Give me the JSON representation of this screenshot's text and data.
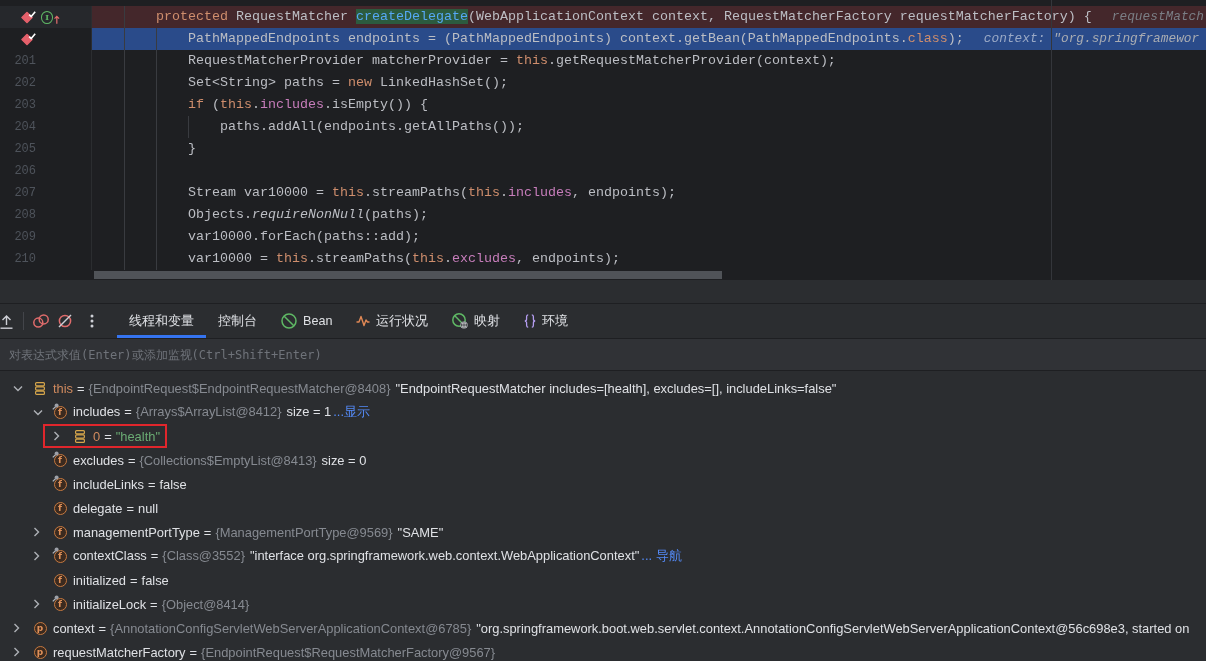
{
  "editor": {
    "lines": [
      {
        "kind": "breakpoint",
        "breakpoint": true,
        "gutter_marker": "I",
        "tokens": [
          {
            "kind": "keyword",
            "text": "    protected"
          },
          {
            "kind": "plain",
            "text": " RequestMatcher "
          },
          {
            "kind": "highlight",
            "text": "createDelegate"
          },
          {
            "kind": "plain",
            "text": "(WebApplicationContext context, RequestMatcherFactory requestMatcherFactory) {"
          }
        ],
        "hint": {
          "label": "requestMatch"
        }
      },
      {
        "kind": "execution",
        "breakpoint": true,
        "tokens": [
          {
            "kind": "plain",
            "text": "        PathMappedEndpoints endpoints = (PathMappedEndpoints) context.getBean(PathMappedEndpoints."
          },
          {
            "kind": "keyword",
            "text": "class"
          },
          {
            "kind": "plain",
            "text": ");"
          }
        ],
        "hint": {
          "label": "context:",
          "value": "\"org.springframewor"
        }
      },
      {
        "kind": "plain",
        "breakpoint": false,
        "number": "201",
        "tokens": [
          {
            "kind": "plain",
            "text": "        RequestMatcherProvider matcherProvider = "
          },
          {
            "kind": "keyword",
            "text": "this"
          },
          {
            "kind": "plain",
            "text": ".getRequestMatcherProvider(context);"
          }
        ]
      },
      {
        "kind": "plain",
        "breakpoint": false,
        "number": "202",
        "tokens": [
          {
            "kind": "plain",
            "text": "        Set<String> paths = "
          },
          {
            "kind": "keyword",
            "text": "new"
          },
          {
            "kind": "plain",
            "text": " LinkedHashSet();"
          }
        ]
      },
      {
        "kind": "plain",
        "breakpoint": false,
        "number": "203",
        "tokens": [
          {
            "kind": "keyword",
            "text": "        if"
          },
          {
            "kind": "plain",
            "text": " ("
          },
          {
            "kind": "keyword",
            "text": "this"
          },
          {
            "kind": "plain",
            "text": "."
          },
          {
            "kind": "field",
            "text": "includes"
          },
          {
            "kind": "plain",
            "text": ".isEmpty()) {"
          }
        ]
      },
      {
        "kind": "plain",
        "breakpoint": false,
        "number": "204",
        "tokens": [
          {
            "kind": "plain",
            "text": "            paths.addAll(endpoints.getAllPaths());"
          }
        ]
      },
      {
        "kind": "plain",
        "breakpoint": false,
        "number": "205",
        "tokens": [
          {
            "kind": "plain",
            "text": "        }"
          }
        ]
      },
      {
        "kind": "plain",
        "breakpoint": false,
        "number": "206"
      },
      {
        "kind": "plain",
        "breakpoint": false,
        "number": "207",
        "tokens": [
          {
            "kind": "plain",
            "text": "        Stream var10000 = "
          },
          {
            "kind": "keyword",
            "text": "this"
          },
          {
            "kind": "plain",
            "text": ".streamPaths("
          },
          {
            "kind": "keyword",
            "text": "this"
          },
          {
            "kind": "plain",
            "text": "."
          },
          {
            "kind": "field",
            "text": "includes"
          },
          {
            "kind": "plain",
            "text": ", endpoints);"
          }
        ]
      },
      {
        "kind": "plain",
        "breakpoint": false,
        "number": "208",
        "tokens": [
          {
            "kind": "plain",
            "text": "        Objects."
          },
          {
            "kind": "italic",
            "text": "requireNonNull"
          },
          {
            "kind": "plain",
            "text": "(paths);"
          }
        ]
      },
      {
        "kind": "plain",
        "breakpoint": false,
        "number": "209",
        "tokens": [
          {
            "kind": "plain",
            "text": "        var10000.forEach(paths::add);"
          }
        ]
      },
      {
        "kind": "plain",
        "breakpoint": false,
        "number": "210",
        "tokens": [
          {
            "kind": "plain",
            "text": "        var10000 = "
          },
          {
            "kind": "keyword",
            "text": "this"
          },
          {
            "kind": "plain",
            "text": ".streamPaths("
          },
          {
            "kind": "keyword",
            "text": "this"
          },
          {
            "kind": "plain",
            "text": "."
          },
          {
            "kind": "field",
            "text": "excludes"
          },
          {
            "kind": "plain",
            "text": ", endpoints);"
          }
        ]
      }
    ]
  },
  "debugger": {
    "buttons": [
      {
        "kind": "export"
      },
      {
        "kind": "breakpoints"
      },
      {
        "kind": "mute"
      },
      {
        "kind": "more"
      }
    ],
    "tabs": [
      {
        "kind": "plain",
        "label": "线程和变量",
        "selected": true
      },
      {
        "kind": "plain",
        "label": "控制台",
        "selected": false
      },
      {
        "kind": "bean",
        "label": "Bean",
        "selected": false
      },
      {
        "kind": "pulse",
        "label": "运行状况",
        "selected": false
      },
      {
        "kind": "mapping",
        "label": "映射",
        "selected": false
      },
      {
        "kind": "braces",
        "label": "环境",
        "selected": false
      }
    ]
  },
  "expression_field": {
    "placeholder": "对表达式求值(Enter)或添加监视(Ctrl+Shift+Enter)"
  },
  "variables": [
    {
      "kind": "this",
      "name": "this",
      "equals": "=",
      "type": "{EndpointRequest$EndpointRequestMatcher@8408}",
      "value": "\"EndpointRequestMatcher includes=[health], excludes=[], includeLinks=false\"",
      "literal": false,
      "expanded": true,
      "highlighted": false,
      "children": [
        {
          "kind": "field",
          "icon_text": "f",
          "final": true,
          "name": "includes",
          "equals": "=",
          "type": "{Arrays$ArrayList@8412}",
          "value": "size = 1",
          "literal": false,
          "link": "...显示",
          "expanded": true,
          "highlighted": false,
          "children": [
            {
              "kind": "element",
              "name": "0",
              "equals": "=",
              "value": "\"health\"",
              "literal": true,
              "expanded": false,
              "highlighted": true
            }
          ]
        },
        {
          "kind": "field",
          "icon_text": "f",
          "final": true,
          "name": "excludes",
          "equals": "=",
          "type": "{Collections$EmptyList@8413}",
          "value": "size = 0",
          "literal": false,
          "highlighted": false
        },
        {
          "kind": "field",
          "icon_text": "f",
          "final": true,
          "name": "includeLinks",
          "equals": "=",
          "value": "false",
          "literal": false,
          "highlighted": false
        },
        {
          "kind": "field",
          "icon_text": "f",
          "final": false,
          "name": "delegate",
          "equals": "=",
          "value": "null",
          "literal": false,
          "highlighted": false
        },
        {
          "kind": "field",
          "icon_text": "f",
          "final": false,
          "name": "managementPortType",
          "equals": "=",
          "type": "{ManagementPortType@9569}",
          "value": "\"SAME\"",
          "literal": false,
          "expanded": false,
          "highlighted": false
        },
        {
          "kind": "field",
          "icon_text": "f",
          "final": true,
          "name": "contextClass",
          "equals": "=",
          "type": "{Class@3552}",
          "value": "\"interface org.springframework.web.context.WebApplicationContext\"",
          "literal": false,
          "link": "... 导航",
          "expanded": false,
          "highlighted": false
        },
        {
          "kind": "field",
          "icon_text": "f",
          "final": false,
          "name": "initialized",
          "equals": "=",
          "value": "false",
          "literal": false,
          "highlighted": false
        },
        {
          "kind": "field",
          "icon_text": "f",
          "final": true,
          "name": "initializeLock",
          "equals": "=",
          "type": "{Object@8414}",
          "expanded": false,
          "highlighted": false
        }
      ]
    },
    {
      "kind": "param",
      "icon_text": "p",
      "name": "context",
      "equals": "=",
      "type": "{AnnotationConfigServletWebServerApplicationContext@6785}",
      "value": "\"org.springframework.boot.web.servlet.context.AnnotationConfigServletWebServerApplicationContext@56c698e3, started on",
      "literal": false,
      "expanded": false,
      "highlighted": false
    },
    {
      "kind": "param",
      "icon_text": "p",
      "name": "requestMatcherFactory",
      "equals": "=",
      "type": "{EndpointRequest$RequestMatcherFactory@9567}",
      "expanded": false,
      "highlighted": false
    }
  ]
}
